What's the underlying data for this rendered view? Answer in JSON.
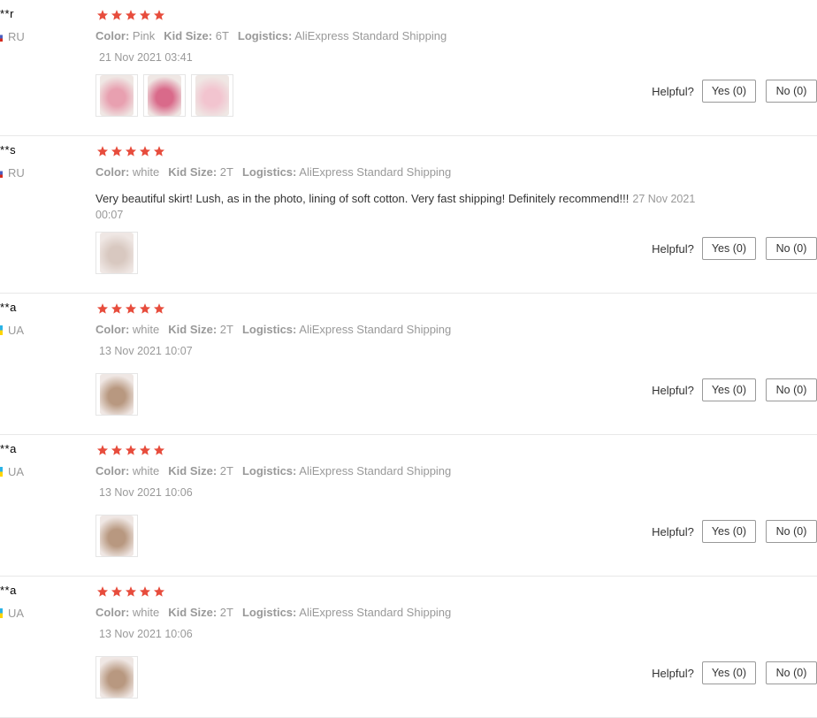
{
  "colors": {
    "star": "#e74c3c",
    "flag_ru": "#4a5fc1",
    "flag_ua": "#2bb3e6"
  },
  "reviews": [
    {
      "user": "**r",
      "country": "RU",
      "rating": 5,
      "attrs": [
        {
          "key": "Color:",
          "value": "Pink"
        },
        {
          "key": "Kid Size:",
          "value": "6T"
        },
        {
          "key": "Logistics:",
          "value": "AliExpress Standard Shipping"
        }
      ],
      "text": "",
      "date": "21 Nov 2021 03:41",
      "photo_count": 3,
      "helpful_label": "Helpful?",
      "yes_label": "Yes (0)",
      "no_label": "No (0)"
    },
    {
      "user": "**s",
      "country": "RU",
      "rating": 5,
      "attrs": [
        {
          "key": "Color:",
          "value": "white"
        },
        {
          "key": "Kid Size:",
          "value": "2T"
        },
        {
          "key": "Logistics:",
          "value": "AliExpress Standard Shipping"
        }
      ],
      "text": "Very beautiful skirt! Lush, as in the photo, lining of soft cotton. Very fast shipping! Definitely recommend!!!",
      "date": "27 Nov 2021 00:07",
      "photo_count": 1,
      "helpful_label": "Helpful?",
      "yes_label": "Yes (0)",
      "no_label": "No (0)"
    },
    {
      "user": "**a",
      "country": "UA",
      "rating": 5,
      "attrs": [
        {
          "key": "Color:",
          "value": "white"
        },
        {
          "key": "Kid Size:",
          "value": "2T"
        },
        {
          "key": "Logistics:",
          "value": "AliExpress Standard Shipping"
        }
      ],
      "text": "",
      "date": "13 Nov 2021 10:07",
      "photo_count": 1,
      "helpful_label": "Helpful?",
      "yes_label": "Yes (0)",
      "no_label": "No (0)"
    },
    {
      "user": "**a",
      "country": "UA",
      "rating": 5,
      "attrs": [
        {
          "key": "Color:",
          "value": "white"
        },
        {
          "key": "Kid Size:",
          "value": "2T"
        },
        {
          "key": "Logistics:",
          "value": "AliExpress Standard Shipping"
        }
      ],
      "text": "",
      "date": "13 Nov 2021 10:06",
      "photo_count": 1,
      "helpful_label": "Helpful?",
      "yes_label": "Yes (0)",
      "no_label": "No (0)"
    },
    {
      "user": "**a",
      "country": "UA",
      "rating": 5,
      "attrs": [
        {
          "key": "Color:",
          "value": "white"
        },
        {
          "key": "Kid Size:",
          "value": "2T"
        },
        {
          "key": "Logistics:",
          "value": "AliExpress Standard Shipping"
        }
      ],
      "text": "",
      "date": "13 Nov 2021 10:06",
      "photo_count": 1,
      "helpful_label": "Helpful?",
      "yes_label": "Yes (0)",
      "no_label": "No (0)"
    }
  ]
}
